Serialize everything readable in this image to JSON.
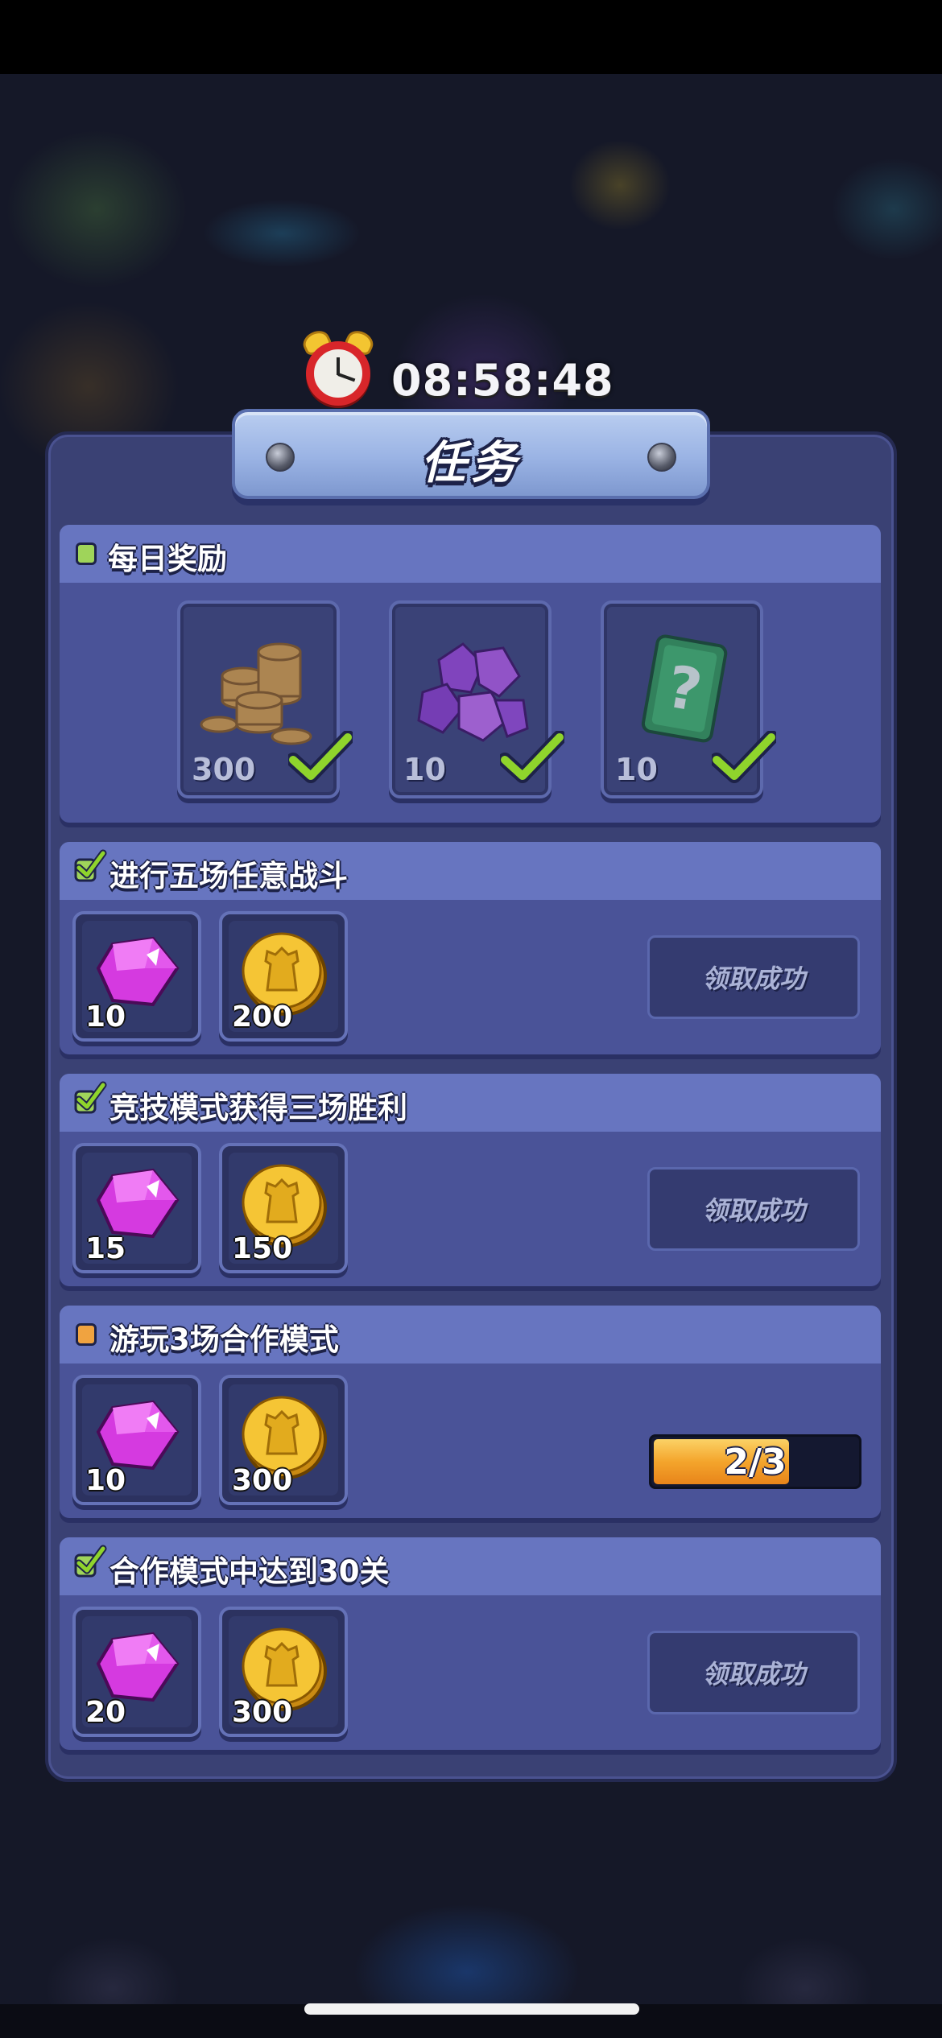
{
  "timer": {
    "remaining": "08:58:48"
  },
  "dialog": {
    "title": "任务"
  },
  "daily": {
    "title": "每日奖励",
    "rewards": [
      {
        "icon": "coin-pile-icon",
        "qty": "300",
        "claimed": true
      },
      {
        "icon": "purple-gem-pile-icon",
        "qty": "10",
        "claimed": true
      },
      {
        "icon": "mystery-card-icon",
        "qty": "10",
        "claimed": true
      }
    ]
  },
  "tasks": [
    {
      "title": "进行五场任意战斗",
      "status": "done",
      "gem_qty": "10",
      "coin_qty": "200",
      "button_label": "领取成功"
    },
    {
      "title": "竞技模式获得三场胜利",
      "status": "done",
      "gem_qty": "15",
      "coin_qty": "150",
      "button_label": "领取成功"
    },
    {
      "title": "游玩3场合作模式",
      "status": "in-progress",
      "gem_qty": "10",
      "coin_qty": "300",
      "progress_text": "2/3",
      "progress_fraction": 0.667
    },
    {
      "title": "合作模式中达到30关",
      "status": "done",
      "gem_qty": "20",
      "coin_qty": "300",
      "button_label": "领取成功"
    }
  ],
  "colors": {
    "panel": "#3a4174",
    "section_header": "#6775c0",
    "progress_fill": "#f4a52c",
    "check": "#8fd42c"
  }
}
